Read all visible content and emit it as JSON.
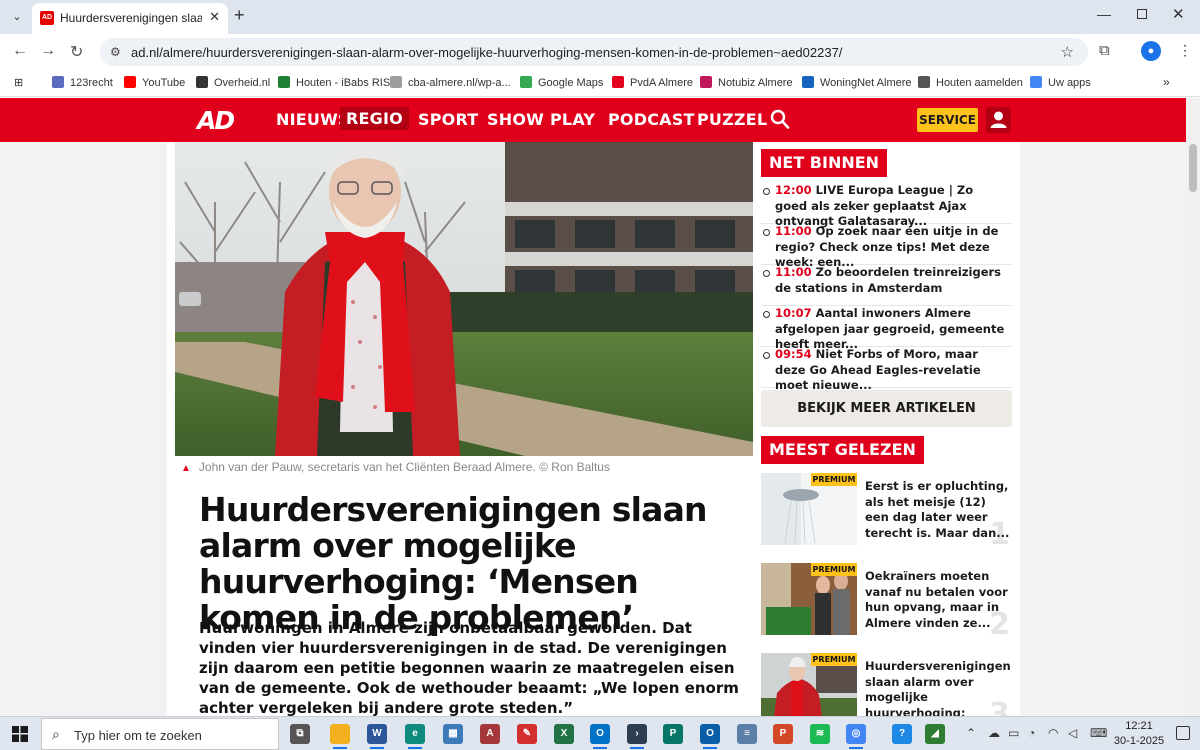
{
  "browser": {
    "tab_title": "Huurdersverenigingen slaan alarm",
    "tab_favicon_text": "AD",
    "url": "ad.nl/almere/huurdersverenigingen-slaan-alarm-over-mogelijke-huurverhoging-mensen-komen-in-de-problemen~aed02237/",
    "bookmarks": [
      {
        "label": "123recht",
        "icon": "calendar-icon",
        "color": "#5c6bc0"
      },
      {
        "label": "YouTube",
        "icon": "youtube-icon",
        "color": "#ff0000"
      },
      {
        "label": "Overheid.nl",
        "icon": "overheid-icon",
        "color": "#333333"
      },
      {
        "label": "Houten - iBabs RIS",
        "icon": "ibabs-icon",
        "color": "#1e7e34"
      },
      {
        "label": "cba-almere.nl/wp-a...",
        "icon": "page-icon",
        "color": "#9e9e9e"
      },
      {
        "label": "Google Maps",
        "icon": "maps-pin-icon",
        "color": "#34a853"
      },
      {
        "label": "PvdA Almere",
        "icon": "pvda-icon",
        "color": "#e3001b"
      },
      {
        "label": "Notubiz Almere",
        "icon": "notubiz-icon",
        "color": "#c2185b"
      },
      {
        "label": "WoningNet Almere",
        "icon": "woningnet-icon",
        "color": "#1565c0"
      },
      {
        "label": "Houten aamelden",
        "icon": "globe-icon",
        "color": "#555555"
      },
      {
        "label": "Uw apps",
        "icon": "google-icon",
        "color": "#4285f4"
      }
    ]
  },
  "site": {
    "logo": "AD",
    "nav": [
      "NIEUWS",
      "REGIO",
      "SPORT",
      "SHOW",
      "PLAY",
      "PODCAST",
      "PUZZEL"
    ],
    "active_nav": "REGIO",
    "service_label": "SERVICE",
    "colors": {
      "brand_red": "#e0001b",
      "service_yellow": "#ffc21a"
    }
  },
  "article": {
    "caption": "John van der Pauw, secretaris van het Cliënten Beraad Almere. © Ron Baltus",
    "headline": "Huurdersverenigingen slaan alarm over mogelijke huurverhoging: ‘Mensen komen in de problemen’",
    "intro": "Huurwoningen in Almere zijn onbetaalbaar geworden. Dat vinden vier huurdersverenigingen in de stad. De verenigingen zijn daarom een petitie begonnen waarin ze maatregelen eisen van de gemeente. Ook de wethouder beaamt: „We lopen enorm achter vergeleken bij andere grote steden.”"
  },
  "sidebar": {
    "net_binnen_label": "NET BINNEN",
    "net_binnen": [
      {
        "time": "12:00",
        "text": "LIVE Europa League | Zo goed als zeker geplaatst Ajax ontvangt Galatasaray..."
      },
      {
        "time": "11:00",
        "text": "Op zoek naar een uitje in de regio? Check onze tips! Met deze week: een..."
      },
      {
        "time": "11:00",
        "text": "Zo beoordelen treinreizigers de stations in Amsterdam"
      },
      {
        "time": "10:07",
        "text": "Aantal inwoners Almere afgelopen jaar gegroeid, gemeente heeft meer..."
      },
      {
        "time": "09:54",
        "text": "Niet Forbs of Moro, maar deze Go Ahead Eagles-revelatie moet nieuwe..."
      }
    ],
    "more_label": "BEKIJK MEER ARTIKELEN",
    "meest_gelezen_label": "MEEST GELEZEN",
    "meest_gelezen": [
      {
        "badge": "PREMIUM",
        "text": "Eerst is er opluchting, als het meisje (12) een dag later weer terecht is. Maar dan...",
        "number": "1"
      },
      {
        "badge": "PREMIUM",
        "text": "Oekraïners moeten vanaf nu betalen voor hun opvang, maar in Almere vinden ze...",
        "number": "2"
      },
      {
        "badge": "PREMIUM",
        "text": "Huurdersverenigingen slaan alarm over mogelijke huurverhoging: ‘Mensen...",
        "number": "3"
      }
    ]
  },
  "taskbar": {
    "search_placeholder": "Typ hier om te zoeken",
    "apps": [
      {
        "name": "task-view-icon",
        "color": "#555555",
        "label": "⧉"
      },
      {
        "name": "file-explorer-icon",
        "color": "#f2b01e",
        "label": ""
      },
      {
        "name": "word-icon",
        "color": "#2b579a",
        "label": "W"
      },
      {
        "name": "edge-icon",
        "color": "#0f8a7e",
        "label": "e"
      },
      {
        "name": "store-icon",
        "color": "#3d7ab8",
        "label": "▦"
      },
      {
        "name": "access-icon",
        "color": "#a4373a",
        "label": "A"
      },
      {
        "name": "acrobat-icon",
        "color": "#d32f2f",
        "label": "✎"
      },
      {
        "name": "excel-icon",
        "color": "#217346",
        "label": "X"
      },
      {
        "name": "outlook-icon",
        "color": "#0072c6",
        "label": "O"
      },
      {
        "name": "powershell-icon",
        "color": "#2c3e50",
        "label": "›"
      },
      {
        "name": "publisher-icon",
        "color": "#077568",
        "label": "P"
      },
      {
        "name": "outlook2-icon",
        "color": "#0a5ea8",
        "label": "O"
      },
      {
        "name": "notepad-icon",
        "color": "#5b7fa6",
        "label": "≡"
      },
      {
        "name": "powerpoint-icon",
        "color": "#d24726",
        "label": "P"
      },
      {
        "name": "spotify-icon",
        "color": "#1db954",
        "label": "≋"
      },
      {
        "name": "chrome-icon",
        "color": "#4285f4",
        "label": "◎"
      },
      {
        "name": "help-icon",
        "color": "#1e88e5",
        "label": "?"
      },
      {
        "name": "chart-app-icon",
        "color": "#2e7d32",
        "label": "◢"
      }
    ],
    "time": "12:21",
    "date": "30-1-2025"
  }
}
